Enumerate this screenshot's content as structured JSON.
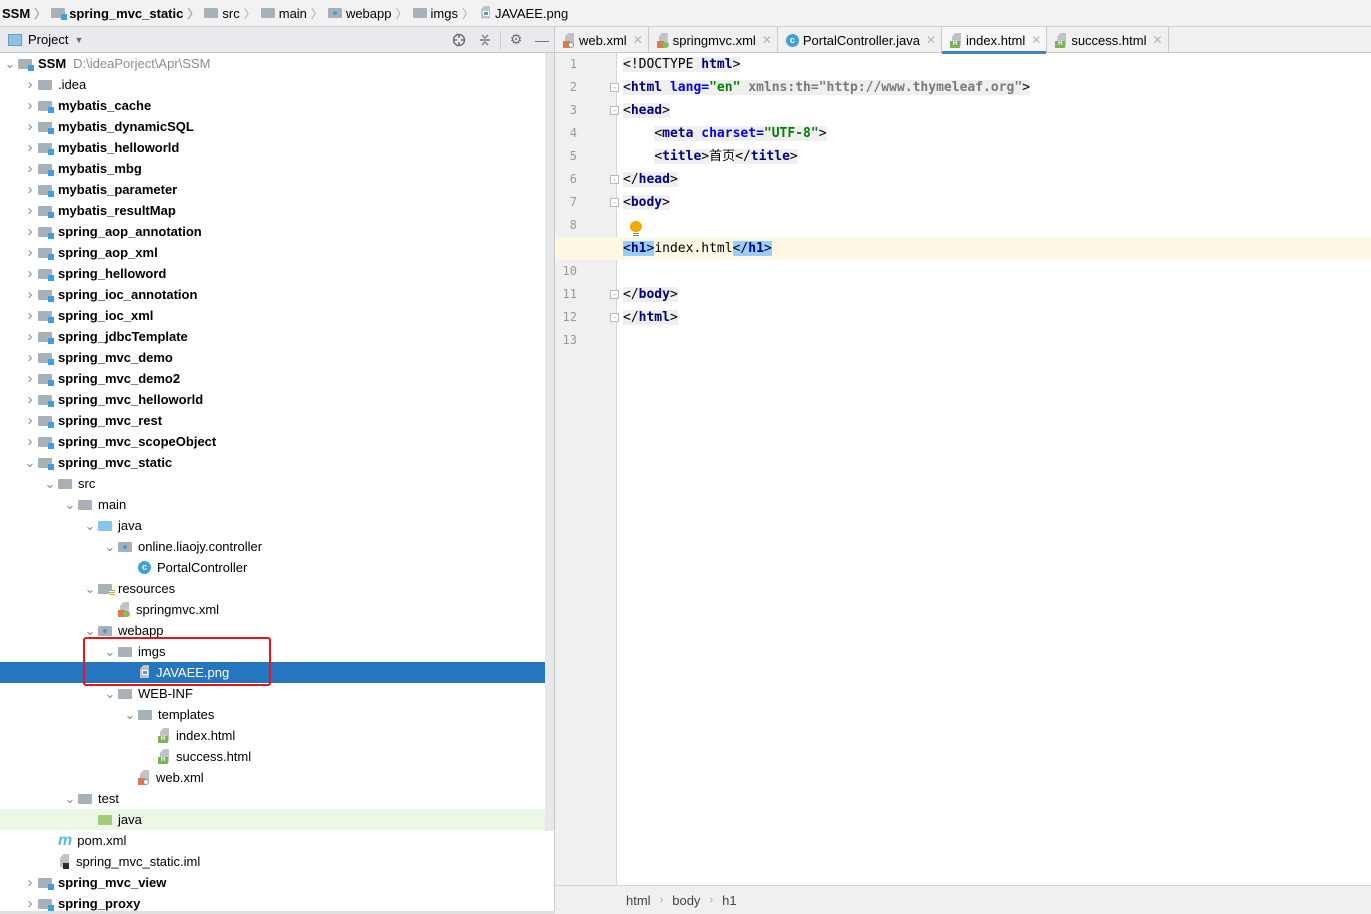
{
  "breadcrumb": [
    {
      "label": "SSM",
      "icon": "module-folder",
      "bold": true
    },
    {
      "label": "spring_mvc_static",
      "icon": "module-folder",
      "bold": true
    },
    {
      "label": "src",
      "icon": "folder"
    },
    {
      "label": "main",
      "icon": "folder"
    },
    {
      "label": "webapp",
      "icon": "web-folder"
    },
    {
      "label": "imgs",
      "icon": "folder"
    },
    {
      "label": "JAVAEE.png",
      "icon": "image-file"
    }
  ],
  "project_panel": {
    "title": "Project",
    "tools": [
      "locate-icon",
      "collapse-all-icon",
      "gear-icon",
      "minimize-icon"
    ]
  },
  "tree": [
    {
      "label": "SSM",
      "path": "D:\\ideaPorject\\Apr\\SSM",
      "depth": 0,
      "expanded": true,
      "icon": "mod",
      "bold": true
    },
    {
      "label": ".idea",
      "depth": 1,
      "expanded": false,
      "icon": "folder"
    },
    {
      "label": "mybatis_cache",
      "depth": 1,
      "expanded": false,
      "icon": "mod",
      "bold": true
    },
    {
      "label": "mybatis_dynamicSQL",
      "depth": 1,
      "expanded": false,
      "icon": "mod",
      "bold": true
    },
    {
      "label": "mybatis_helloworld",
      "depth": 1,
      "expanded": false,
      "icon": "mod",
      "bold": true
    },
    {
      "label": "mybatis_mbg",
      "depth": 1,
      "expanded": false,
      "icon": "mod",
      "bold": true
    },
    {
      "label": "mybatis_parameter",
      "depth": 1,
      "expanded": false,
      "icon": "mod",
      "bold": true
    },
    {
      "label": "mybatis_resultMap",
      "depth": 1,
      "expanded": false,
      "icon": "mod",
      "bold": true
    },
    {
      "label": "spring_aop_annotation",
      "depth": 1,
      "expanded": false,
      "icon": "mod",
      "bold": true
    },
    {
      "label": "spring_aop_xml",
      "depth": 1,
      "expanded": false,
      "icon": "mod",
      "bold": true
    },
    {
      "label": "spring_helloword",
      "depth": 1,
      "expanded": false,
      "icon": "mod",
      "bold": true
    },
    {
      "label": "spring_ioc_annotation",
      "depth": 1,
      "expanded": false,
      "icon": "mod",
      "bold": true
    },
    {
      "label": "spring_ioc_xml",
      "depth": 1,
      "expanded": false,
      "icon": "mod",
      "bold": true
    },
    {
      "label": "spring_jdbcTemplate",
      "depth": 1,
      "expanded": false,
      "icon": "mod",
      "bold": true
    },
    {
      "label": "spring_mvc_demo",
      "depth": 1,
      "expanded": false,
      "icon": "mod",
      "bold": true
    },
    {
      "label": "spring_mvc_demo2",
      "depth": 1,
      "expanded": false,
      "icon": "mod",
      "bold": true
    },
    {
      "label": "spring_mvc_helloworld",
      "depth": 1,
      "expanded": false,
      "icon": "mod",
      "bold": true
    },
    {
      "label": "spring_mvc_rest",
      "depth": 1,
      "expanded": false,
      "icon": "mod",
      "bold": true
    },
    {
      "label": "spring_mvc_scopeObject",
      "depth": 1,
      "expanded": false,
      "icon": "mod",
      "bold": true
    },
    {
      "label": "spring_mvc_static",
      "depth": 1,
      "expanded": true,
      "icon": "mod",
      "bold": true
    },
    {
      "label": "src",
      "depth": 2,
      "expanded": true,
      "icon": "folder"
    },
    {
      "label": "main",
      "depth": 3,
      "expanded": true,
      "icon": "folder"
    },
    {
      "label": "java",
      "depth": 4,
      "expanded": true,
      "icon": "src"
    },
    {
      "label": "online.liaojy.controller",
      "depth": 5,
      "expanded": true,
      "icon": "package"
    },
    {
      "label": "PortalController",
      "depth": 6,
      "icon": "class"
    },
    {
      "label": "resources",
      "depth": 4,
      "expanded": true,
      "icon": "res"
    },
    {
      "label": "springmvc.xml",
      "depth": 5,
      "icon": "spring-xml"
    },
    {
      "label": "webapp",
      "depth": 4,
      "expanded": true,
      "icon": "web"
    },
    {
      "label": "imgs",
      "depth": 5,
      "expanded": true,
      "icon": "folder"
    },
    {
      "label": "JAVAEE.png",
      "depth": 6,
      "icon": "image",
      "selected": true
    },
    {
      "label": "WEB-INF",
      "depth": 5,
      "expanded": true,
      "icon": "folder"
    },
    {
      "label": "templates",
      "depth": 6,
      "expanded": true,
      "icon": "folder"
    },
    {
      "label": "index.html",
      "depth": 7,
      "icon": "html"
    },
    {
      "label": "success.html",
      "depth": 7,
      "icon": "html"
    },
    {
      "label": "web.xml",
      "depth": 6,
      "icon": "web-xml"
    },
    {
      "label": "test",
      "depth": 3,
      "expanded": true,
      "icon": "folder"
    },
    {
      "label": "java",
      "depth": 4,
      "icon": "test",
      "highlighted": true
    },
    {
      "label": "pom.xml",
      "depth": 2,
      "icon": "maven"
    },
    {
      "label": "spring_mvc_static.iml",
      "depth": 2,
      "icon": "iml"
    },
    {
      "label": "spring_mvc_view",
      "depth": 1,
      "expanded": false,
      "icon": "mod",
      "bold": true
    },
    {
      "label": "spring_proxy",
      "depth": 1,
      "expanded": false,
      "icon": "mod",
      "bold": true
    }
  ],
  "tabs": [
    {
      "label": "web.xml",
      "icon": "web-xml"
    },
    {
      "label": "springmvc.xml",
      "icon": "spring-xml"
    },
    {
      "label": "PortalController.java",
      "icon": "class"
    },
    {
      "label": "index.html",
      "icon": "html",
      "active": true
    },
    {
      "label": "success.html",
      "icon": "html"
    }
  ],
  "editor": {
    "current_line": 9,
    "lines": [
      [
        {
          "t": "<!DOCTYPE ",
          "c": "pl tagbg"
        },
        {
          "t": "html",
          "c": "kw tagbg"
        },
        {
          "t": ">",
          "c": "pl tagbg"
        }
      ],
      [
        {
          "t": "<",
          "c": "pl tagbg"
        },
        {
          "t": "html ",
          "c": "kw tagbg"
        },
        {
          "t": "lang",
          "c": "at tagbg"
        },
        {
          "t": "=",
          "c": "at tagbg"
        },
        {
          "t": "\"en\" ",
          "c": "st tagbg"
        },
        {
          "t": "xmlns:th=\"http://www.thymeleaf.org\"",
          "c": "gr tagbg"
        },
        {
          "t": ">",
          "c": "pl tagbg"
        }
      ],
      [
        {
          "t": "<",
          "c": "pl tagbg"
        },
        {
          "t": "head",
          "c": "kw tagbg"
        },
        {
          "t": ">",
          "c": "pl tagbg"
        }
      ],
      [
        {
          "t": "    ",
          "c": "pl"
        },
        {
          "t": "<",
          "c": "pl tagbg"
        },
        {
          "t": "meta ",
          "c": "kw tagbg"
        },
        {
          "t": "charset",
          "c": "at tagbg"
        },
        {
          "t": "=",
          "c": "at tagbg"
        },
        {
          "t": "\"UTF-8\"",
          "c": "st tagbg"
        },
        {
          "t": ">",
          "c": "pl tagbg"
        }
      ],
      [
        {
          "t": "    ",
          "c": "pl"
        },
        {
          "t": "<",
          "c": "pl tagbg"
        },
        {
          "t": "title",
          "c": "kw tagbg"
        },
        {
          "t": ">",
          "c": "pl tagbg"
        },
        {
          "t": "首页",
          "c": "pl"
        },
        {
          "t": "</",
          "c": "pl tagbg"
        },
        {
          "t": "title",
          "c": "kw tagbg"
        },
        {
          "t": ">",
          "c": "pl tagbg"
        }
      ],
      [
        {
          "t": "</",
          "c": "pl tagbg"
        },
        {
          "t": "head",
          "c": "kw tagbg"
        },
        {
          "t": ">",
          "c": "pl tagbg"
        }
      ],
      [
        {
          "t": "<",
          "c": "pl tagbg"
        },
        {
          "t": "body",
          "c": "kw tagbg"
        },
        {
          "t": ">",
          "c": "pl tagbg"
        }
      ],
      [],
      [
        {
          "t": "<",
          "c": "pl match"
        },
        {
          "t": "h1",
          "c": "kw match"
        },
        {
          "t": ">",
          "c": "pl match"
        },
        {
          "t": "index.html",
          "c": "pl"
        },
        {
          "t": "</",
          "c": "pl match"
        },
        {
          "t": "h1",
          "c": "kw match"
        },
        {
          "t": ">",
          "c": "pl match"
        }
      ],
      [],
      [
        {
          "t": "</",
          "c": "pl tagbg"
        },
        {
          "t": "body",
          "c": "kw tagbg"
        },
        {
          "t": ">",
          "c": "pl tagbg"
        }
      ],
      [
        {
          "t": "</",
          "c": "pl tagbg"
        },
        {
          "t": "html",
          "c": "kw tagbg"
        },
        {
          "t": ">",
          "c": "pl tagbg"
        }
      ],
      []
    ],
    "fold_lines": [
      2,
      3,
      6,
      7,
      11,
      12
    ]
  },
  "status_breadcrumb": [
    "html",
    "body",
    "h1"
  ],
  "colors": {
    "selection": "#2675bf",
    "highlight_box": "#e8161b",
    "active_tab_underline": "#4083c9"
  }
}
